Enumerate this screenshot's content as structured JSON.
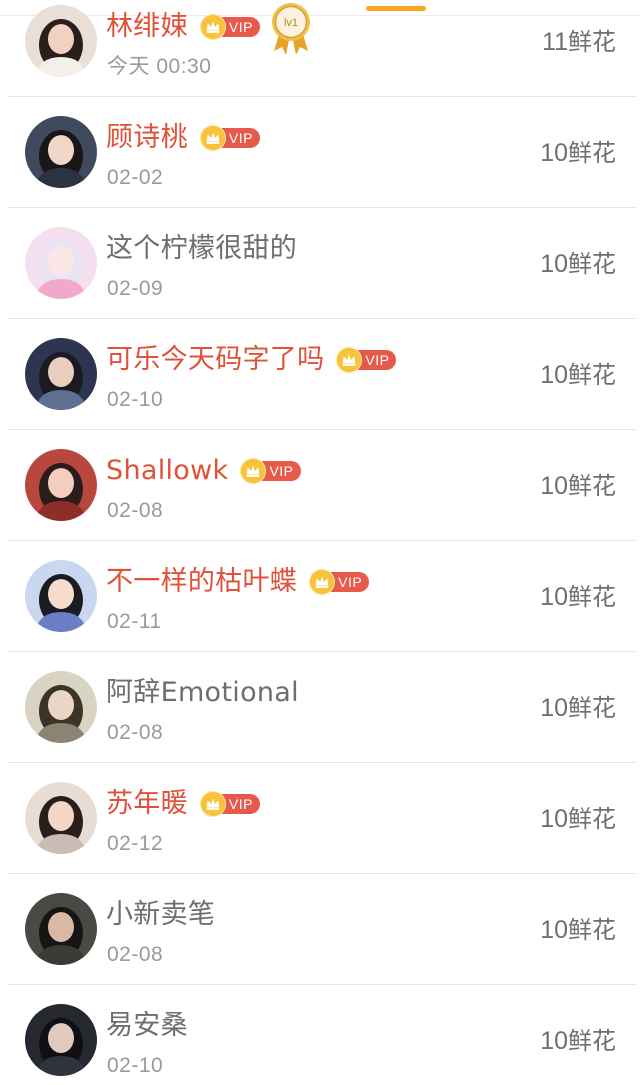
{
  "colors": {
    "accent": "#f5a623",
    "vip_name": "#e0513a",
    "vip_pill": "#e65a4c",
    "vip_crown": "#f7c33b",
    "normal_name": "#6e6e6e",
    "time": "#9a9a9a",
    "divider": "#e6e6e6"
  },
  "medal": {
    "label": "lv1",
    "icon": "medal-icon"
  },
  "vip_label": "VIP",
  "rows": [
    {
      "name": "林绯娕",
      "vip": true,
      "medal": true,
      "time": "今天 00:30",
      "flowers_count": "11",
      "flowers_unit": "鲜花",
      "avatar": {
        "bg": "#e9dfd6",
        "skin": "#f1d2c0",
        "hair": "#2b1f1d",
        "cloth": "#f4efe9"
      }
    },
    {
      "name": "顾诗桃",
      "vip": true,
      "medal": false,
      "time": "02-02",
      "flowers_count": "10",
      "flowers_unit": "鲜花",
      "avatar": {
        "bg": "#3f4a5c",
        "skin": "#f2d6c8",
        "hair": "#1a1516",
        "cloth": "#2c3340"
      }
    },
    {
      "name": "这个柠檬很甜的",
      "vip": false,
      "medal": false,
      "time": "02-09",
      "flowers_count": "10",
      "flowers_unit": "鲜花",
      "avatar": {
        "bg": "#f3dff0",
        "skin": "#fbe6e6",
        "hair": "#e9e4f4",
        "cloth": "#f2a9c9"
      }
    },
    {
      "name": "可乐今天码字了吗",
      "vip": true,
      "medal": false,
      "time": "02-10",
      "flowers_count": "10",
      "flowers_unit": "鲜花",
      "avatar": {
        "bg": "#2d3550",
        "skin": "#e9cdbd",
        "hair": "#1b1a22",
        "cloth": "#5f6f92"
      }
    },
    {
      "name": "Shallowk",
      "vip": true,
      "medal": false,
      "time": "02-08",
      "flowers_count": "10",
      "flowers_unit": "鲜花",
      "avatar": {
        "bg": "#b8473d",
        "skin": "#f4cdbf",
        "hair": "#2a1c1a",
        "cloth": "#8e2e2a"
      }
    },
    {
      "name": "不一样的枯叶蝶",
      "vip": true,
      "medal": false,
      "time": "02-11",
      "flowers_count": "10",
      "flowers_unit": "鲜花",
      "avatar": {
        "bg": "#c9d8ef",
        "skin": "#f6dccc",
        "hair": "#1b1b24",
        "cloth": "#6a7fc4"
      }
    },
    {
      "name": "阿辞Emotional",
      "vip": false,
      "medal": false,
      "time": "02-08",
      "flowers_count": "10",
      "flowers_unit": "鲜花",
      "avatar": {
        "bg": "#d9d3c2",
        "skin": "#e9d6c4",
        "hair": "#3b3429",
        "cloth": "#8a8472"
      }
    },
    {
      "name": "苏年暖",
      "vip": true,
      "medal": false,
      "time": "02-12",
      "flowers_count": "10",
      "flowers_unit": "鲜花",
      "avatar": {
        "bg": "#e8ddd5",
        "skin": "#f2d7c6",
        "hair": "#2a1e1c",
        "cloth": "#c9bcb2"
      }
    },
    {
      "name": "小新卖笔",
      "vip": false,
      "medal": false,
      "time": "02-08",
      "flowers_count": "10",
      "flowers_unit": "鲜花",
      "avatar": {
        "bg": "#4a4a44",
        "skin": "#d9b9a4",
        "hair": "#151515",
        "cloth": "#3a3a36"
      }
    },
    {
      "name": "易安桑",
      "vip": false,
      "medal": false,
      "time": "02-10",
      "flowers_count": "10",
      "flowers_unit": "鲜花",
      "avatar": {
        "bg": "#262830",
        "skin": "#e2c9bd",
        "hair": "#101014",
        "cloth": "#30333e"
      }
    }
  ]
}
